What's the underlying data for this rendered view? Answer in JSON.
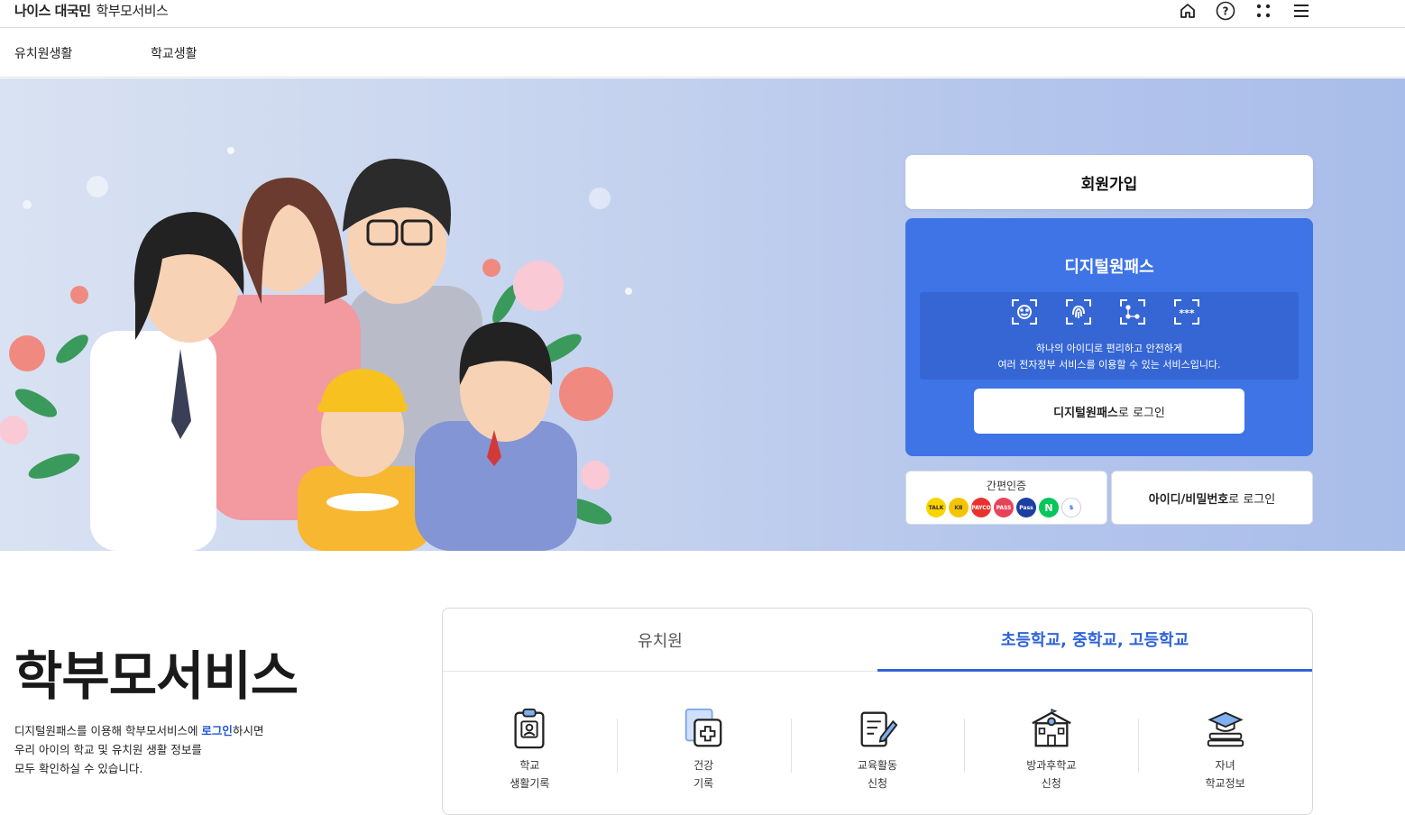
{
  "header": {
    "brand_bold": "나이스 대국민",
    "brand_light": "학부모서비스",
    "icons": [
      "home-icon",
      "help-icon",
      "apps-icon",
      "menu-icon"
    ]
  },
  "nav": {
    "items": [
      {
        "label": "유치원생활"
      },
      {
        "label": "학교생활"
      }
    ]
  },
  "hero": {
    "join_label": "회원가입",
    "digital_pass": {
      "title": "디지털원패스",
      "auth_icons": [
        "face-id-icon",
        "fingerprint-icon",
        "pattern-icon",
        "pin-icon"
      ],
      "desc_line1": "하나의 아이디로 편리하고 안전하게",
      "desc_line2": "여러 전자정부 서비스를 이용할 수 있는 서비스입니다.",
      "login_bold": "디지털원패스",
      "login_rest": "로 로그인"
    },
    "simple_auth": {
      "label": "간편인증",
      "providers": [
        {
          "name": "kakao-talk-icon",
          "text": "TALK",
          "color": "#f7d600"
        },
        {
          "name": "kb-icon",
          "text": "KB",
          "color": "#f5c400"
        },
        {
          "name": "payco-icon",
          "text": "PAYCO",
          "color": "#e8322e"
        },
        {
          "name": "pass-icon",
          "text": "PASS",
          "color": "#e84259"
        },
        {
          "name": "samsung-pass-icon",
          "text": "Pass",
          "color": "#1b3fa0"
        },
        {
          "name": "naver-icon",
          "text": "N",
          "color": "#03c75a"
        },
        {
          "name": "shinhan-icon",
          "text": "S",
          "color": "#0046ff"
        }
      ]
    },
    "id_login_bold": "아이디/비밀번호",
    "id_login_rest": "로 로그인"
  },
  "intro": {
    "title": "학부모서비스",
    "line1_pre": "디지털원패스를 이용해 학부모서비스에 ",
    "line1_link": "로그인",
    "line1_post": "하시면",
    "line2": "우리 아이의 학교 및 유치원 생활 정보를",
    "line3": "모두 확인하실 수 있습니다."
  },
  "services": {
    "tabs": [
      {
        "label": "유치원",
        "active": false
      },
      {
        "label": "초등학교, 중학교, 고등학교",
        "active": true
      }
    ],
    "items": [
      {
        "label": "학교\n생활기록",
        "icon": "record-icon"
      },
      {
        "label": "건강\n기록",
        "icon": "health-icon"
      },
      {
        "label": "교육활동\n신청",
        "icon": "activity-icon"
      },
      {
        "label": "방과후학교\n신청",
        "icon": "school-icon"
      },
      {
        "label": "자녀\n학교정보",
        "icon": "graduation-icon"
      }
    ]
  },
  "colors": {
    "accent": "#2f63d9",
    "pass_panel": "#3e74e6"
  }
}
